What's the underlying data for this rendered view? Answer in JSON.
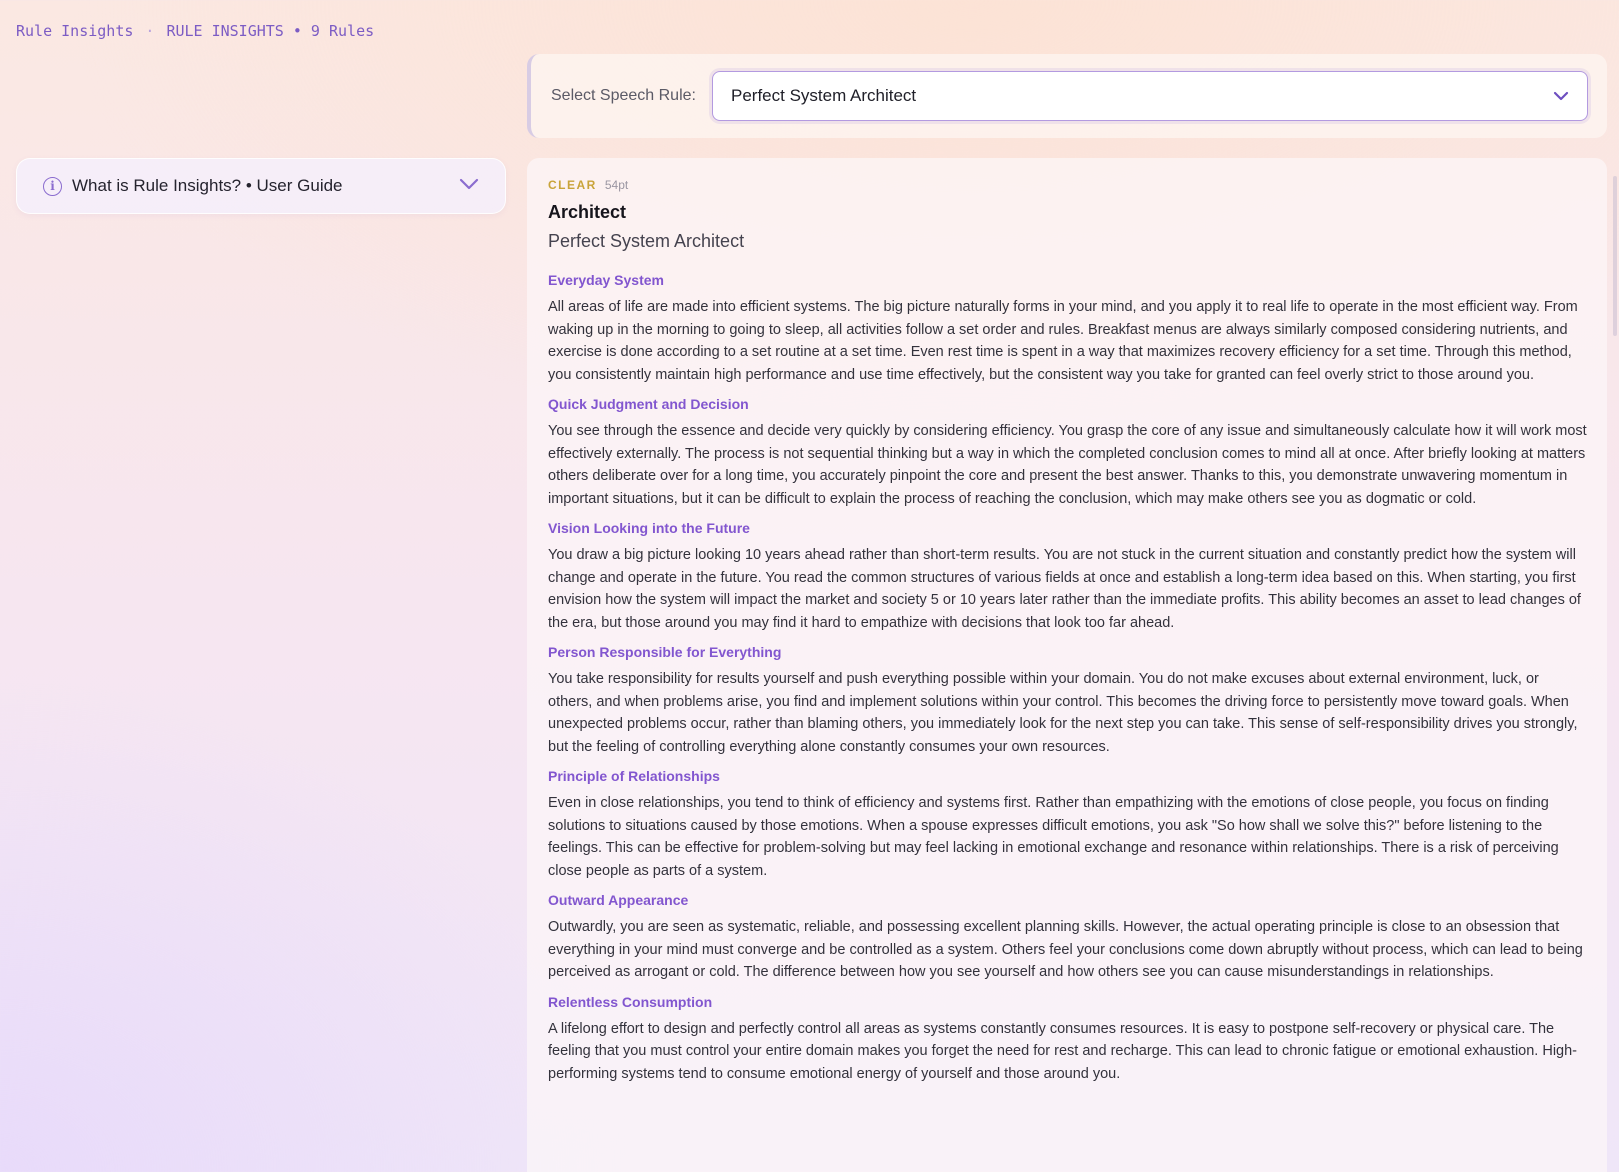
{
  "header": {
    "breadcrumb_app": "Rule Insights",
    "breadcrumb_sep": "·",
    "breadcrumb_context": "RULE INSIGHTS • 9 Rules"
  },
  "sidebar": {
    "guide_title": "What is Rule Insights? • User Guide",
    "info_icon": "info-icon",
    "chevron_icon": "chevron-down-icon"
  },
  "selector": {
    "label": "Select Speech Rule:",
    "value": "Perfect System Architect"
  },
  "rule": {
    "tag": "CLEAR",
    "size": "54pt",
    "title": "Architect",
    "subtitle": "Perfect System Architect",
    "sections": [
      {
        "heading": "Everyday System",
        "body": "All areas of life are made into efficient systems. The big picture naturally forms in your mind, and you apply it to real life to operate in the most efficient way. From waking up in the morning to going to sleep, all activities follow a set order and rules. Breakfast menus are always similarly composed considering nutrients, and exercise is done according to a set routine at a set time. Even rest time is spent in a way that maximizes recovery efficiency for a set time. Through this method, you consistently maintain high performance and use time effectively, but the consistent way you take for granted can feel overly strict to those around you."
      },
      {
        "heading": "Quick Judgment and Decision",
        "body": "You see through the essence and decide very quickly by considering efficiency. You grasp the core of any issue and simultaneously calculate how it will work most effectively externally. The process is not sequential thinking but a way in which the completed conclusion comes to mind all at once. After briefly looking at matters others deliberate over for a long time, you accurately pinpoint the core and present the best answer. Thanks to this, you demonstrate unwavering momentum in important situations, but it can be difficult to explain the process of reaching the conclusion, which may make others see you as dogmatic or cold."
      },
      {
        "heading": "Vision Looking into the Future",
        "body": "You draw a big picture looking 10 years ahead rather than short-term results. You are not stuck in the current situation and constantly predict how the system will change and operate in the future. You read the common structures of various fields at once and establish a long-term idea based on this. When starting, you first envision how the system will impact the market and society 5 or 10 years later rather than the immediate profits. This ability becomes an asset to lead changes of the era, but those around you may find it hard to empathize with decisions that look too far ahead."
      },
      {
        "heading": "Person Responsible for Everything",
        "body": "You take responsibility for results yourself and push everything possible within your domain. You do not make excuses about external environment, luck, or others, and when problems arise, you find and implement solutions within your control. This becomes the driving force to persistently move toward goals. When unexpected problems occur, rather than blaming others, you immediately look for the next step you can take. This sense of self-responsibility drives you strongly, but the feeling of controlling everything alone constantly consumes your own resources."
      },
      {
        "heading": "Principle of Relationships",
        "body": "Even in close relationships, you tend to think of efficiency and systems first. Rather than empathizing with the emotions of close people, you focus on finding solutions to situations caused by those emotions. When a spouse expresses difficult emotions, you ask \"So how shall we solve this?\" before listening to the feelings. This can be effective for problem-solving but may feel lacking in emotional exchange and resonance within relationships. There is a risk of perceiving close people as parts of a system."
      },
      {
        "heading": "Outward Appearance",
        "body": "Outwardly, you are seen as systematic, reliable, and possessing excellent planning skills. However, the actual operating principle is close to an obsession that everything in your mind must converge and be controlled as a system. Others feel your conclusions come down abruptly without process, which can lead to being perceived as arrogant or cold. The difference between how you see yourself and how others see you can cause misunderstandings in relationships."
      },
      {
        "heading": "Relentless Consumption",
        "body": "A lifelong effort to design and perfectly control all areas as systems constantly consumes resources. It is easy to postpone self-recovery or physical care. The feeling that you must control your entire domain makes you forget the need for rest and recharge. This can lead to chronic fatigue or emotional exhaustion. High-performing systems tend to consume emotional energy of yourself and those around you."
      }
    ]
  },
  "colors": {
    "accent": "#8256cf",
    "tag": "#c9a43a",
    "border": "#b39ae0"
  }
}
